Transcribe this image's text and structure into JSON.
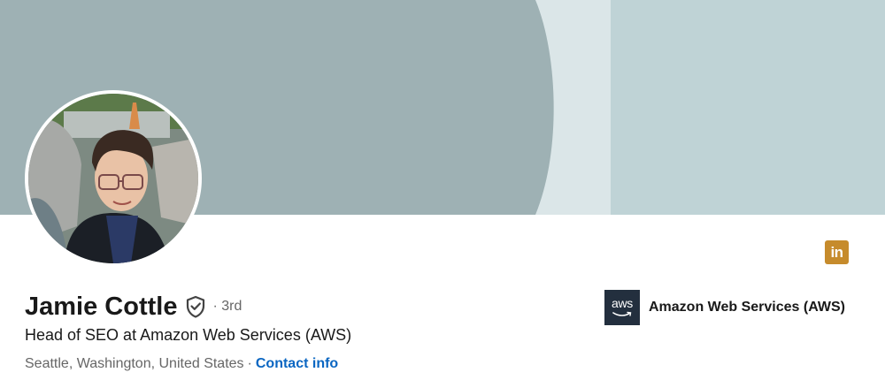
{
  "profile": {
    "name": "Jamie Cottle",
    "degree": "· 3rd",
    "headline": "Head of SEO at Amazon Web Services (AWS)",
    "location": "Seattle, Washington, United States",
    "separator": "·",
    "contact_label": "Contact info"
  },
  "company": {
    "logo_text": "aws",
    "name": "Amazon Web Services (AWS)"
  },
  "icons": {
    "linkedin_text": "in"
  },
  "colors": {
    "banner_main": "#9eb1b4",
    "banner_light": "#dbe6e8",
    "banner_right": "#bfd3d6",
    "link": "#0a66c2",
    "linkedin_badge": "#c68b2c",
    "aws_logo_bg": "#232f3e"
  }
}
